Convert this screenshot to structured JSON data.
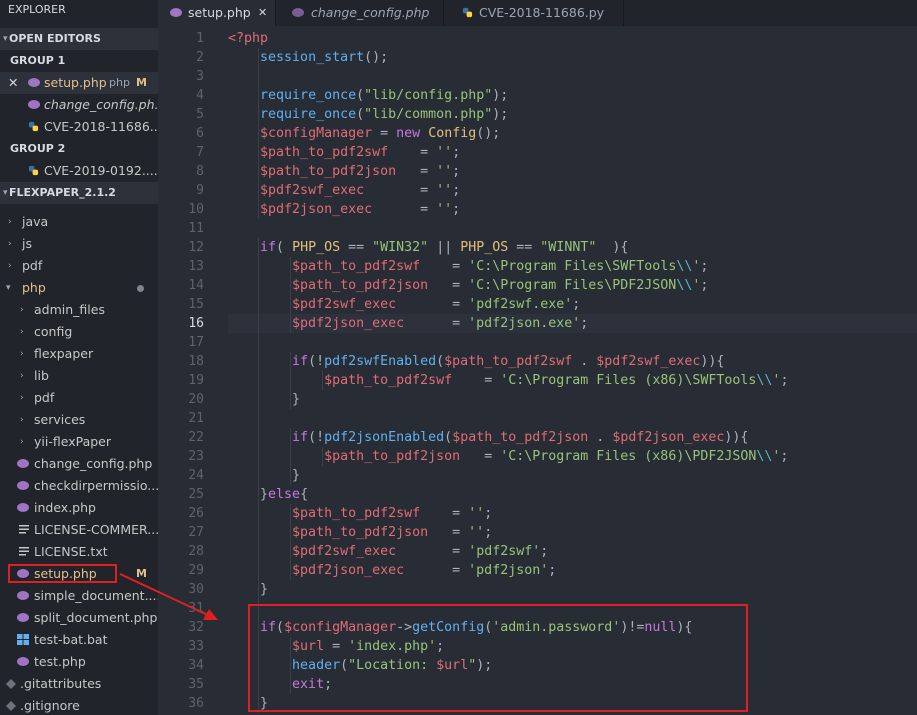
{
  "sidebar": {
    "title": "EXPLORER",
    "open_editors_header": "OPEN EDITORS",
    "group1_label": "GROUP 1",
    "group1_items": [
      {
        "label": "setup.php",
        "path": "php",
        "status": "M",
        "close": "✕"
      },
      {
        "label": "change_config.ph..."
      },
      {
        "label": "CVE-2018-11686...."
      }
    ],
    "group2_label": "GROUP 2",
    "group2_items": [
      {
        "label": "CVE-2019-0192...."
      }
    ],
    "project_header": "FLEXPAPER_2.1.2",
    "tree": [
      {
        "label": "java"
      },
      {
        "label": "js"
      },
      {
        "label": "pdf"
      },
      {
        "label": "php"
      },
      {
        "label": "admin_files"
      },
      {
        "label": "config"
      },
      {
        "label": "flexpaper"
      },
      {
        "label": "lib"
      },
      {
        "label": "pdf"
      },
      {
        "label": "services"
      },
      {
        "label": "yii-flexPaper"
      },
      {
        "label": "change_config.php"
      },
      {
        "label": "checkdirpermissio..."
      },
      {
        "label": "index.php"
      },
      {
        "label": "LICENSE-COMMER..."
      },
      {
        "label": "LICENSE.txt"
      },
      {
        "label": "setup.php",
        "status": "M"
      },
      {
        "label": "simple_document...."
      },
      {
        "label": "split_document.php"
      },
      {
        "label": "test-bat.bat"
      },
      {
        "label": "test.php"
      },
      {
        "label": ".gitattributes"
      },
      {
        "label": ".gitignore"
      }
    ]
  },
  "tabs": [
    {
      "label": "setup.php",
      "close": "✕"
    },
    {
      "label": "change_config.php"
    },
    {
      "label": "CVE-2018-11686.py"
    }
  ],
  "editor": {
    "current_line": 16,
    "line_numbers": [
      "1",
      "2",
      "3",
      "4",
      "5",
      "6",
      "7",
      "8",
      "9",
      "10",
      "11",
      "12",
      "13",
      "14",
      "15",
      "16",
      "17",
      "18",
      "19",
      "20",
      "21",
      "22",
      "23",
      "24",
      "25",
      "26",
      "27",
      "28",
      "29",
      "30",
      "31",
      "32",
      "33",
      "34",
      "35",
      "36"
    ],
    "code_lines": [
      [
        {
          "t": "t",
          "x": "<?php"
        }
      ],
      [
        {
          "t": "p",
          "x": "    "
        },
        {
          "t": "f",
          "x": "session_start"
        },
        {
          "t": "p",
          "x": "();"
        }
      ],
      [],
      [
        {
          "t": "p",
          "x": "    "
        },
        {
          "t": "f",
          "x": "require_once"
        },
        {
          "t": "p",
          "x": "("
        },
        {
          "t": "s",
          "x": "\"lib/config.php\""
        },
        {
          "t": "p",
          "x": ");"
        }
      ],
      [
        {
          "t": "p",
          "x": "    "
        },
        {
          "t": "f",
          "x": "require_once"
        },
        {
          "t": "p",
          "x": "("
        },
        {
          "t": "s",
          "x": "\"lib/common.php\""
        },
        {
          "t": "p",
          "x": ");"
        }
      ],
      [
        {
          "t": "p",
          "x": "    "
        },
        {
          "t": "v",
          "x": "$configManager"
        },
        {
          "t": "p",
          "x": " = "
        },
        {
          "t": "k",
          "x": "new"
        },
        {
          "t": "p",
          "x": " "
        },
        {
          "t": "c",
          "x": "Config"
        },
        {
          "t": "p",
          "x": "();"
        }
      ],
      [
        {
          "t": "p",
          "x": "    "
        },
        {
          "t": "v",
          "x": "$path_to_pdf2swf"
        },
        {
          "t": "p",
          "x": "    = "
        },
        {
          "t": "s",
          "x": "''"
        },
        {
          "t": "p",
          "x": ";"
        }
      ],
      [
        {
          "t": "p",
          "x": "    "
        },
        {
          "t": "v",
          "x": "$path_to_pdf2json"
        },
        {
          "t": "p",
          "x": "   = "
        },
        {
          "t": "s",
          "x": "''"
        },
        {
          "t": "p",
          "x": ";"
        }
      ],
      [
        {
          "t": "p",
          "x": "    "
        },
        {
          "t": "v",
          "x": "$pdf2swf_exec"
        },
        {
          "t": "p",
          "x": "       = "
        },
        {
          "t": "s",
          "x": "''"
        },
        {
          "t": "p",
          "x": ";"
        }
      ],
      [
        {
          "t": "p",
          "x": "    "
        },
        {
          "t": "v",
          "x": "$pdf2json_exec"
        },
        {
          "t": "p",
          "x": "      = "
        },
        {
          "t": "s",
          "x": "''"
        },
        {
          "t": "p",
          "x": ";"
        }
      ],
      [],
      [
        {
          "t": "p",
          "x": "    "
        },
        {
          "t": "k",
          "x": "if"
        },
        {
          "t": "p",
          "x": "( "
        },
        {
          "t": "c",
          "x": "PHP_OS"
        },
        {
          "t": "p",
          "x": " == "
        },
        {
          "t": "s",
          "x": "\"WIN32\""
        },
        {
          "t": "p",
          "x": " || "
        },
        {
          "t": "c",
          "x": "PHP_OS"
        },
        {
          "t": "p",
          "x": " == "
        },
        {
          "t": "s",
          "x": "\"WINNT\""
        },
        {
          "t": "p",
          "x": "  ){"
        }
      ],
      [
        {
          "t": "p",
          "x": "        "
        },
        {
          "t": "v",
          "x": "$path_to_pdf2swf"
        },
        {
          "t": "p",
          "x": "    = "
        },
        {
          "t": "s",
          "x": "'C:\\Program Files\\SWFTools"
        },
        {
          "t": "o",
          "x": "\\\\"
        },
        {
          "t": "s",
          "x": "'"
        },
        {
          "t": "p",
          "x": ";"
        }
      ],
      [
        {
          "t": "p",
          "x": "        "
        },
        {
          "t": "v",
          "x": "$path_to_pdf2json"
        },
        {
          "t": "p",
          "x": "   = "
        },
        {
          "t": "s",
          "x": "'C:\\Program Files\\PDF2JSON"
        },
        {
          "t": "o",
          "x": "\\\\"
        },
        {
          "t": "s",
          "x": "'"
        },
        {
          "t": "p",
          "x": ";"
        }
      ],
      [
        {
          "t": "p",
          "x": "        "
        },
        {
          "t": "v",
          "x": "$pdf2swf_exec"
        },
        {
          "t": "p",
          "x": "       = "
        },
        {
          "t": "s",
          "x": "'pdf2swf.exe'"
        },
        {
          "t": "p",
          "x": ";"
        }
      ],
      [
        {
          "t": "p",
          "x": "        "
        },
        {
          "t": "v",
          "x": "$pdf2json_exec"
        },
        {
          "t": "p",
          "x": "      = "
        },
        {
          "t": "s",
          "x": "'pdf2json.exe'"
        },
        {
          "t": "p",
          "x": ";"
        }
      ],
      [],
      [
        {
          "t": "p",
          "x": "        "
        },
        {
          "t": "k",
          "x": "if"
        },
        {
          "t": "p",
          "x": "(!"
        },
        {
          "t": "f",
          "x": "pdf2swfEnabled"
        },
        {
          "t": "p",
          "x": "("
        },
        {
          "t": "v",
          "x": "$path_to_pdf2swf"
        },
        {
          "t": "p",
          "x": " . "
        },
        {
          "t": "v",
          "x": "$pdf2swf_exec"
        },
        {
          "t": "p",
          "x": ")){"
        }
      ],
      [
        {
          "t": "p",
          "x": "            "
        },
        {
          "t": "v",
          "x": "$path_to_pdf2swf"
        },
        {
          "t": "p",
          "x": "    = "
        },
        {
          "t": "s",
          "x": "'C:\\Program Files (x86)\\SWFTools"
        },
        {
          "t": "o",
          "x": "\\\\"
        },
        {
          "t": "s",
          "x": "'"
        },
        {
          "t": "p",
          "x": ";"
        }
      ],
      [
        {
          "t": "p",
          "x": "        }"
        }
      ],
      [],
      [
        {
          "t": "p",
          "x": "        "
        },
        {
          "t": "k",
          "x": "if"
        },
        {
          "t": "p",
          "x": "(!"
        },
        {
          "t": "f",
          "x": "pdf2jsonEnabled"
        },
        {
          "t": "p",
          "x": "("
        },
        {
          "t": "v",
          "x": "$path_to_pdf2json"
        },
        {
          "t": "p",
          "x": " . "
        },
        {
          "t": "v",
          "x": "$pdf2json_exec"
        },
        {
          "t": "p",
          "x": ")){"
        }
      ],
      [
        {
          "t": "p",
          "x": "            "
        },
        {
          "t": "v",
          "x": "$path_to_pdf2json"
        },
        {
          "t": "p",
          "x": "   = "
        },
        {
          "t": "s",
          "x": "'C:\\Program Files (x86)\\PDF2JSON"
        },
        {
          "t": "o",
          "x": "\\\\"
        },
        {
          "t": "s",
          "x": "'"
        },
        {
          "t": "p",
          "x": ";"
        }
      ],
      [
        {
          "t": "p",
          "x": "        }"
        }
      ],
      [
        {
          "t": "p",
          "x": "    }"
        },
        {
          "t": "k",
          "x": "else"
        },
        {
          "t": "p",
          "x": "{"
        }
      ],
      [
        {
          "t": "p",
          "x": "        "
        },
        {
          "t": "v",
          "x": "$path_to_pdf2swf"
        },
        {
          "t": "p",
          "x": "    = "
        },
        {
          "t": "s",
          "x": "''"
        },
        {
          "t": "p",
          "x": ";"
        }
      ],
      [
        {
          "t": "p",
          "x": "        "
        },
        {
          "t": "v",
          "x": "$path_to_pdf2json"
        },
        {
          "t": "p",
          "x": "   = "
        },
        {
          "t": "s",
          "x": "''"
        },
        {
          "t": "p",
          "x": ";"
        }
      ],
      [
        {
          "t": "p",
          "x": "        "
        },
        {
          "t": "v",
          "x": "$pdf2swf_exec"
        },
        {
          "t": "p",
          "x": "       = "
        },
        {
          "t": "s",
          "x": "'pdf2swf'"
        },
        {
          "t": "p",
          "x": ";"
        }
      ],
      [
        {
          "t": "p",
          "x": "        "
        },
        {
          "t": "v",
          "x": "$pdf2json_exec"
        },
        {
          "t": "p",
          "x": "      = "
        },
        {
          "t": "s",
          "x": "'pdf2json'"
        },
        {
          "t": "p",
          "x": ";"
        }
      ],
      [
        {
          "t": "p",
          "x": "    }"
        }
      ],
      [],
      [
        {
          "t": "p",
          "x": "    "
        },
        {
          "t": "k",
          "x": "if"
        },
        {
          "t": "p",
          "x": "("
        },
        {
          "t": "v",
          "x": "$configManager"
        },
        {
          "t": "p",
          "x": "->"
        },
        {
          "t": "f",
          "x": "getConfig"
        },
        {
          "t": "p",
          "x": "("
        },
        {
          "t": "s",
          "x": "'admin.password'"
        },
        {
          "t": "p",
          "x": ")!="
        },
        {
          "t": "k",
          "x": "null"
        },
        {
          "t": "p",
          "x": "){"
        }
      ],
      [
        {
          "t": "p",
          "x": "        "
        },
        {
          "t": "v",
          "x": "$url"
        },
        {
          "t": "p",
          "x": " = "
        },
        {
          "t": "s",
          "x": "'index.php'"
        },
        {
          "t": "p",
          "x": ";"
        }
      ],
      [
        {
          "t": "p",
          "x": "        "
        },
        {
          "t": "f",
          "x": "header"
        },
        {
          "t": "p",
          "x": "("
        },
        {
          "t": "s",
          "x": "\"Location: "
        },
        {
          "t": "v",
          "x": "$url"
        },
        {
          "t": "s",
          "x": "\""
        },
        {
          "t": "p",
          "x": ");"
        }
      ],
      [
        {
          "t": "p",
          "x": "        "
        },
        {
          "t": "k",
          "x": "exit"
        },
        {
          "t": "p",
          "x": ";"
        }
      ],
      [
        {
          "t": "p",
          "x": "    }"
        }
      ]
    ]
  },
  "icons": {
    "php": "php-elephant-icon",
    "python": "python-icon",
    "folder_chevron": "chevron-right-icon"
  },
  "colors": {
    "highlight_box": "#e02020",
    "php_icon": "#a074c4",
    "python_icon": "#3572a5",
    "modified": "#e2c08d"
  }
}
